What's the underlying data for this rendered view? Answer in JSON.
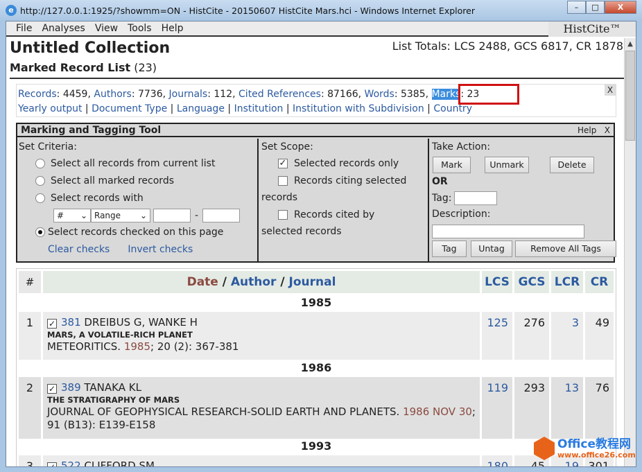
{
  "window": {
    "title": "http://127.0.0.1:1925/?showmm=ON - HistCite - 20150607 HistCite Mars.hci - Windows Internet Explorer",
    "minimize": "–",
    "maximize": "□",
    "close": "X"
  },
  "menu": {
    "items": [
      "File",
      "Analyses",
      "View",
      "Tools",
      "Help"
    ],
    "brand": "HistCite™"
  },
  "header": {
    "title": "Untitled Collection",
    "totals": "List Totals: LCS 2488, GCS 6817, CR 1878",
    "subtitle": "Marked Record List",
    "subtitle_count": "(23)"
  },
  "stats": {
    "records_label": "Records",
    "records": ": 4459, ",
    "authors_label": "Authors",
    "authors": ": 7736, ",
    "journals_label": "Journals",
    "journals": ": 112, ",
    "cited_label": "Cited References",
    "cited": ": 87166, ",
    "words_label": "Words",
    "words": ": 5385, ",
    "marks_label": "Marks",
    "marks": ": 23",
    "links": [
      "Yearly output",
      "Document Type",
      "Language",
      "Institution",
      "Institution with Subdivision",
      "Country"
    ],
    "close": "X"
  },
  "tool": {
    "title": "Marking and Tagging Tool",
    "help": "Help",
    "close": "X",
    "criteria": {
      "label": "Set Criteria:",
      "opt1": "Select all records from current list",
      "opt2": "Select all marked records",
      "opt3": "Select records with",
      "field_select": "#",
      "range_select": "Range",
      "dash": "-",
      "opt4": "Select records checked on this page",
      "selected_option": 4,
      "clear": "Clear checks",
      "invert": "Invert checks"
    },
    "scope": {
      "label": "Set Scope:",
      "opt1": "Selected records only",
      "opt1_checked": true,
      "opt2a": "Records citing selected",
      "opt2b": "records",
      "opt3a": "Records cited by",
      "opt3b": "selected records"
    },
    "action": {
      "label": "Take Action:",
      "mark": "Mark",
      "unmark": "Unmark",
      "delete": "Delete",
      "or": "OR",
      "tag_label": "Tag:",
      "desc_label": "Description:",
      "tag": "Tag",
      "untag": "Untag",
      "remove_all": "Remove All Tags"
    }
  },
  "table": {
    "headers": {
      "hash": "#",
      "date": "Date",
      "sep": " / ",
      "author": "Author",
      "journal": "Journal",
      "lcs": "LCS",
      "gcs": "GCS",
      "lcr": "LCR",
      "cr": "CR"
    },
    "groups": [
      {
        "year": "1985",
        "rec": {
          "n": "1",
          "id": "381",
          "authors": "DREIBUS G, WANKE H",
          "title": "MARS, A VOLATILE-RICH PLANET",
          "journal": "METEORITICS. ",
          "date": "1985",
          "rest": "; 20 (2): 367-381",
          "lcs": "125",
          "gcs": "276",
          "lcr": "3",
          "cr": "49"
        }
      },
      {
        "year": "1986",
        "rec": {
          "n": "2",
          "id": "389",
          "authors": "TANAKA KL",
          "title": "THE STRATIGRAPHY OF MARS",
          "journal": "JOURNAL OF GEOPHYSICAL RESEARCH-SOLID EARTH AND PLANETS. ",
          "date": "1986 NOV 30",
          "rest": "; 91 (B13): E139-E158",
          "lcs": "119",
          "gcs": "293",
          "lcr": "13",
          "cr": "76"
        }
      },
      {
        "year": "1993",
        "rec": {
          "n": "3",
          "id": "522",
          "authors": "CLIFFORD SM",
          "lcs": "180",
          "gcs": "45",
          "lcr": "19",
          "cr": "301"
        }
      }
    ]
  },
  "watermark": {
    "line1": "Office教程网",
    "line2": "www.office26.com"
  }
}
